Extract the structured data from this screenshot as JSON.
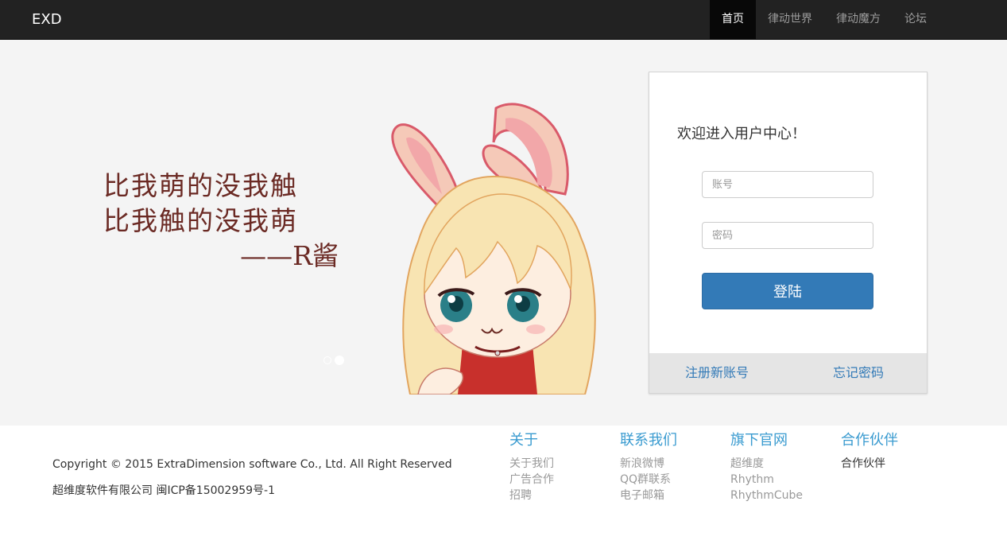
{
  "nav": {
    "brand": "EXD",
    "items": [
      {
        "label": "首页"
      },
      {
        "label": "律动世界"
      },
      {
        "label": "律动魔方"
      },
      {
        "label": "论坛"
      }
    ]
  },
  "hero": {
    "slogan_line1": "比我萌的没我触",
    "slogan_line2": "比我触的没我萌",
    "slogan_signature": "——R酱",
    "carousel_dots": 2,
    "carousel_active_index": 1
  },
  "login": {
    "title": "欢迎进入用户中心！",
    "account_placeholder": "账号",
    "password_placeholder": "密码",
    "submit_label": "登陆",
    "register_link": "注册新账号",
    "forgot_link": "忘记密码"
  },
  "footer": {
    "copyright": "Copyright © 2015 ExtraDimension software Co., Ltd. All Right Reserved",
    "icp": "超维度软件有限公司 闽ICP备15002959号-1",
    "columns": [
      {
        "title": "关于",
        "items": [
          "关于我们",
          "广告合作",
          "招聘"
        ]
      },
      {
        "title": "联系我们",
        "items": [
          "新浪微博",
          "QQ群联系",
          "电子邮箱"
        ]
      },
      {
        "title": "旗下官网",
        "items": [
          "超维度",
          "Rhythm",
          "RhythmCube"
        ]
      },
      {
        "title": "合作伙伴",
        "items": [
          "合作伙伴"
        ]
      }
    ]
  },
  "colors": {
    "navbar": "#222222",
    "nav_active": "#080808",
    "primary": "#337ab7",
    "footer_heading": "#3a9bd0",
    "hero_bg": "#f4f4f4"
  }
}
